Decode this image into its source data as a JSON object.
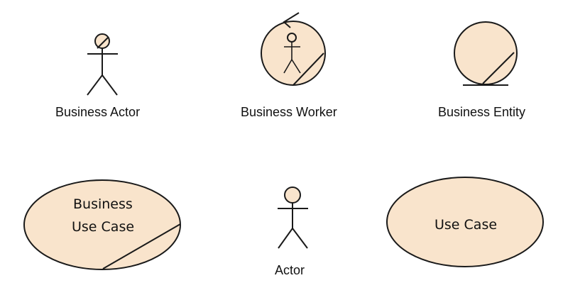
{
  "diagram": {
    "labels": {
      "business_actor": "Business Actor",
      "business_worker": "Business Worker",
      "business_entity": "Business Entity",
      "business_use_case_line1": "Business",
      "business_use_case_line2": "Use Case",
      "actor": "Actor",
      "use_case": "Use Case"
    },
    "colors": {
      "fill": "#f9e4cc",
      "stroke": "#1a1a1a",
      "text": "#111111"
    }
  }
}
